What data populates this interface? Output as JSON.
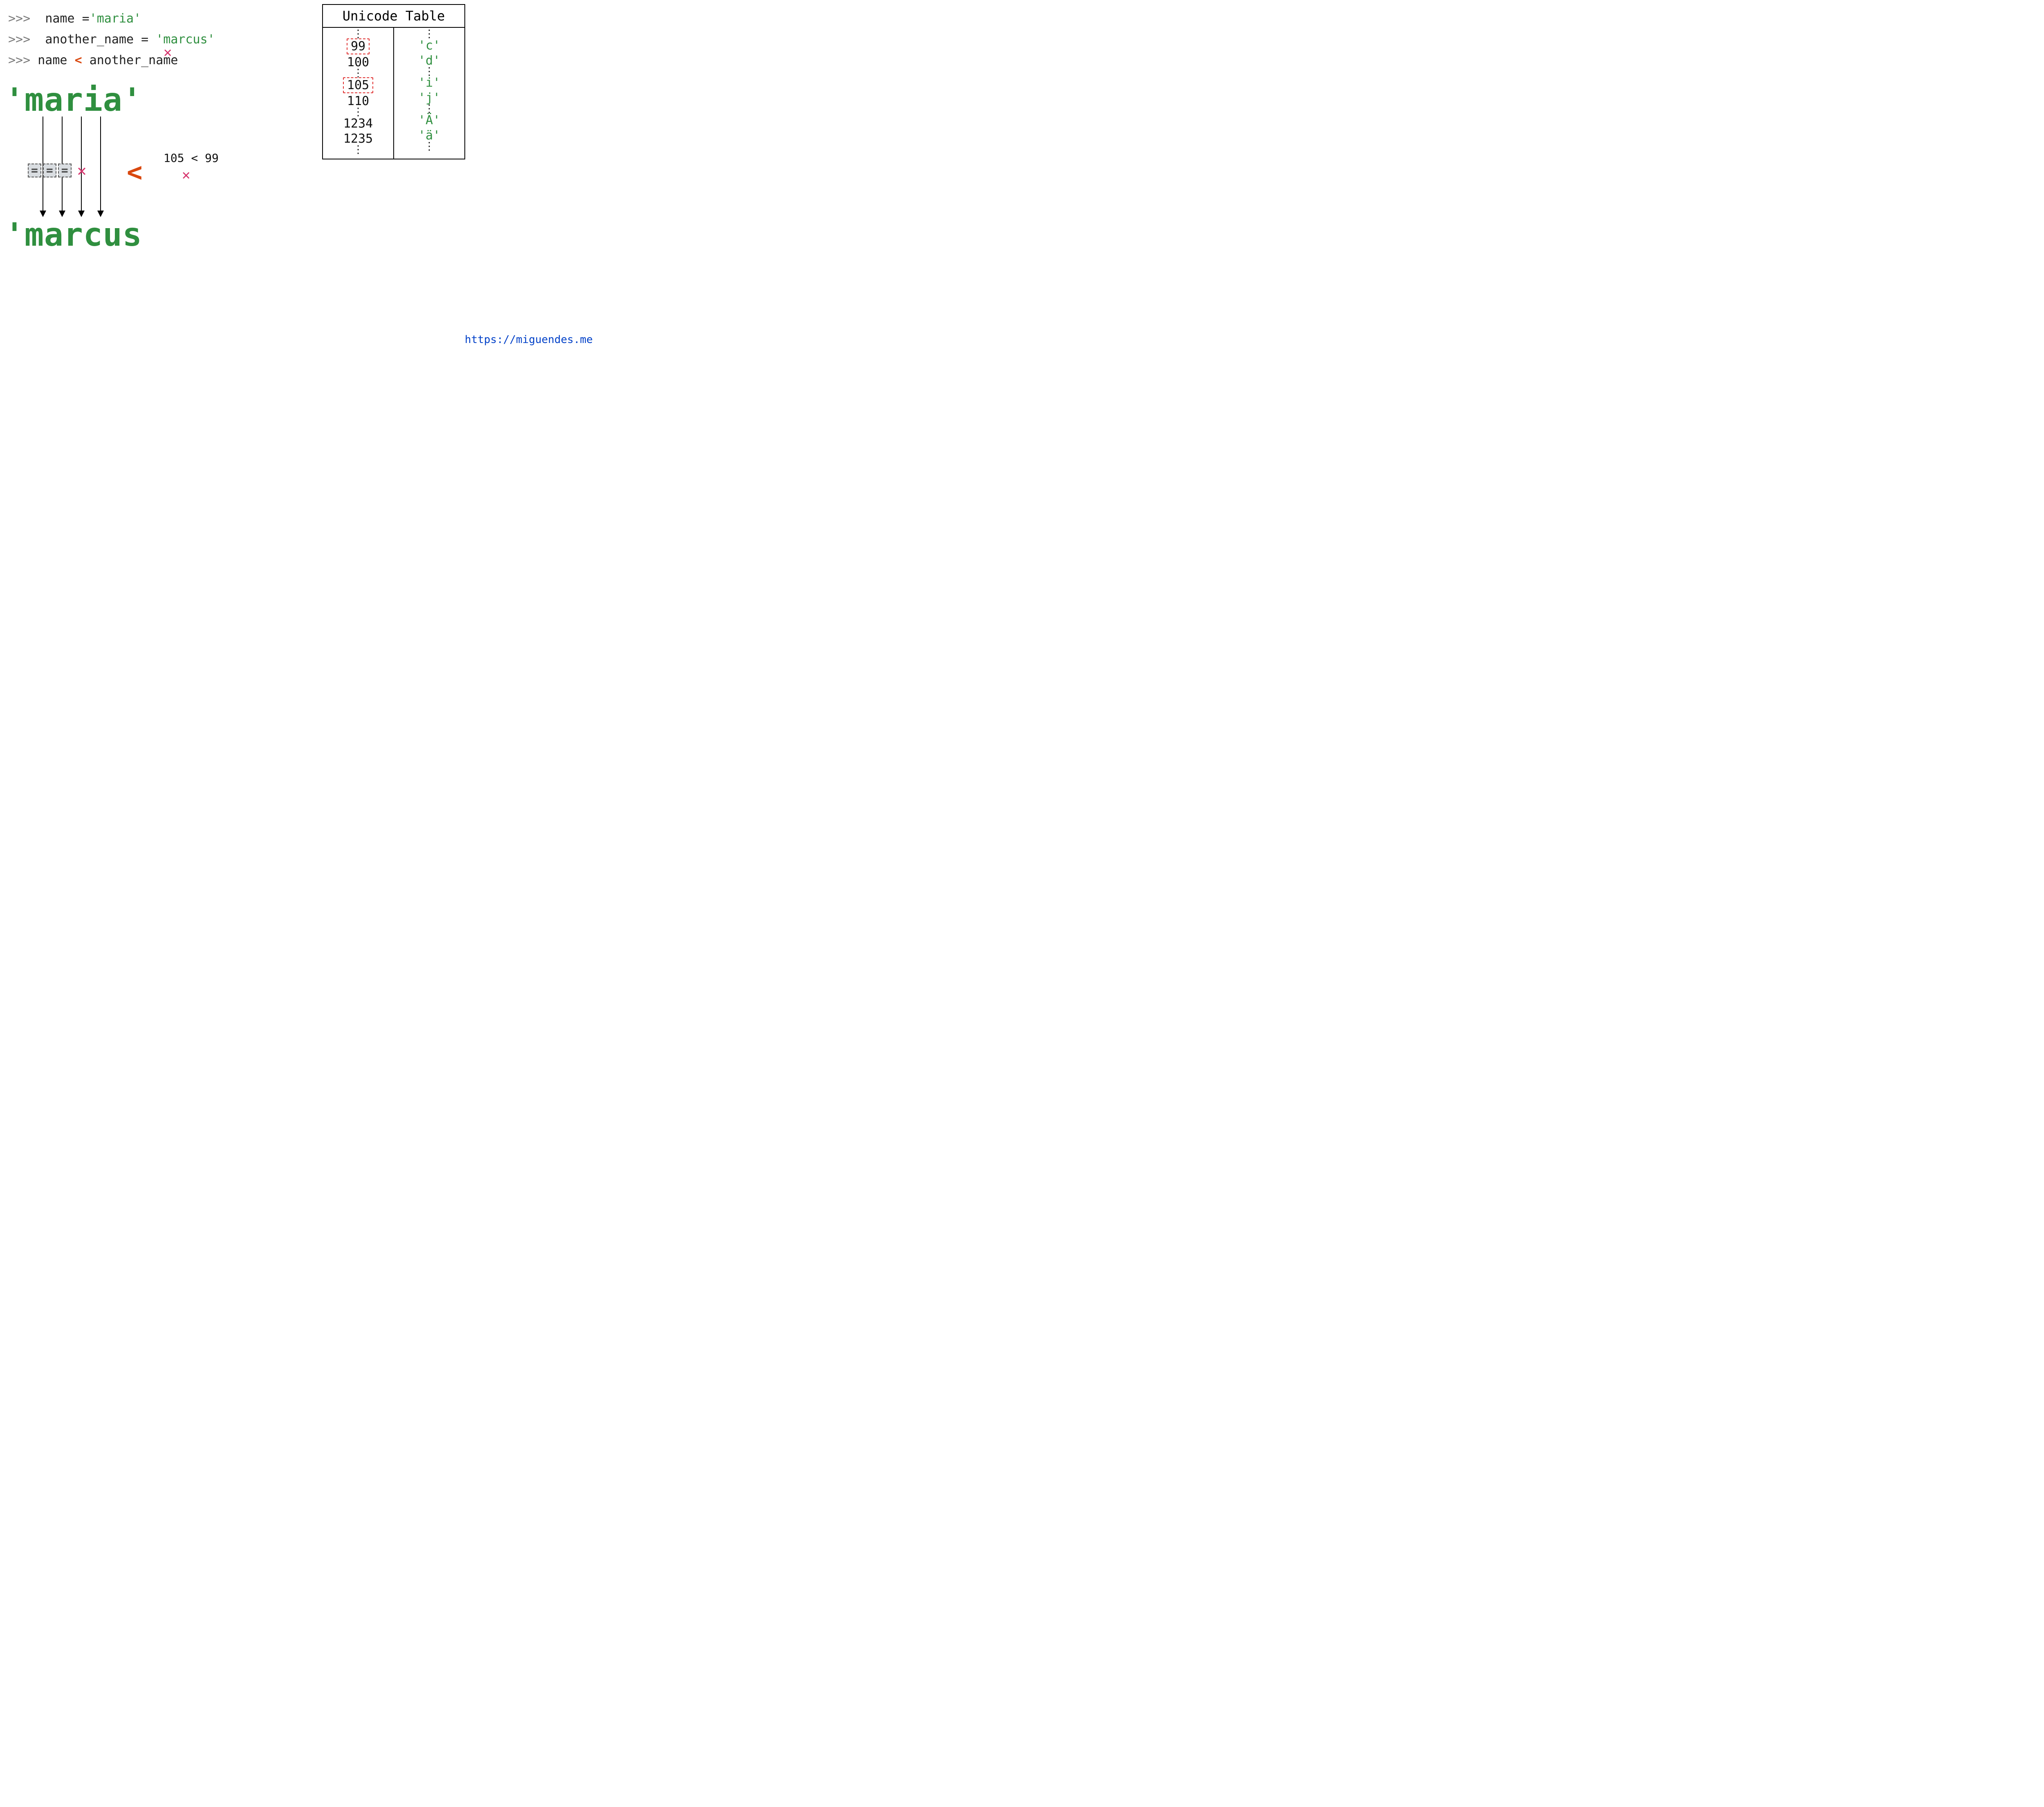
{
  "code": {
    "prompt": ">>>",
    "line1_lhs": "name",
    "line1_eq": "=",
    "line1_rhs": "'maria'",
    "line2_lhs": "another_name",
    "line2_eq": "=",
    "line2_rhs": "'marcus'",
    "line3_lhs": "name",
    "line3_op": "<",
    "line3_rhs": "another_name"
  },
  "words": {
    "top": "'maria'",
    "bottom": "'marcus"
  },
  "compare": {
    "eq_symbol": "=",
    "big_lt": "<",
    "expr": "105 < 99"
  },
  "icons": {
    "cross": "✕"
  },
  "unicode_table": {
    "title": "Unicode Table",
    "vdots": "⋮",
    "rows": [
      {
        "code": "99",
        "char": "'c'",
        "highlight": true
      },
      {
        "code": "100",
        "char": "'d'",
        "highlight": false
      },
      {
        "code": "105",
        "char": "'i'",
        "highlight": true
      },
      {
        "code": "110",
        "char": "'j'",
        "highlight": false
      },
      {
        "code": "1234",
        "char": "'Ä'",
        "highlight": false
      },
      {
        "code": "1235",
        "char": "'ä'",
        "highlight": false
      }
    ]
  },
  "link": "https://miguendes.me"
}
